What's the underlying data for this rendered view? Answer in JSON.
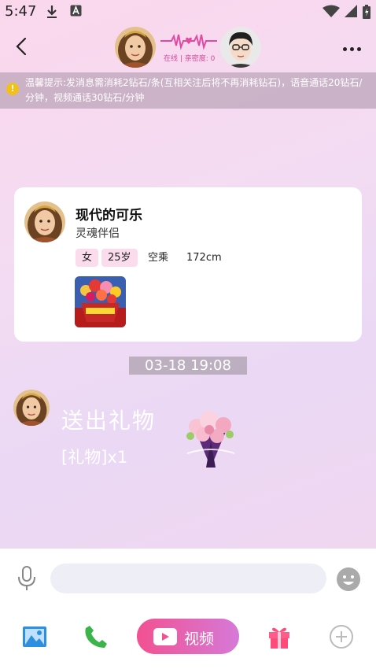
{
  "status_bar": {
    "time": "5:47",
    "icons": [
      "download-icon",
      "text-a-icon",
      "wifi-icon",
      "signal-icon",
      "battery-icon"
    ]
  },
  "header": {
    "online_status": "在线 | 亲密度: 0",
    "icons": [
      "back-arrow-icon",
      "heartbeat-icon",
      "more-icon"
    ]
  },
  "notice": {
    "text": "温馨提示:发消息需消耗2钻石/条(互相关注后将不再消耗钻石)，语音通话20钻石/分钟，视频通话30钻石/分钟",
    "icon": "warning-icon"
  },
  "profile": {
    "name": "现代的可乐",
    "subtitle": "灵魂伴侣",
    "tags": [
      "女",
      "25岁",
      "空乘",
      "172cm"
    ]
  },
  "chat": {
    "timestamp": "03-18 19:08",
    "gift_title": "送出礼物",
    "gift_sub": "[礼物]x1"
  },
  "input_bar": {
    "placeholder": "",
    "video_label": "视频",
    "icons": [
      "microphone-icon",
      "emoji-icon",
      "image-icon",
      "phone-icon",
      "video-camera-icon",
      "gift-icon",
      "plus-circle-icon"
    ]
  },
  "colors": {
    "accent": "#f25191",
    "accent_end": "#d679d8",
    "tag_bg": "#fbdcec",
    "phone_green": "#3bb54a"
  }
}
